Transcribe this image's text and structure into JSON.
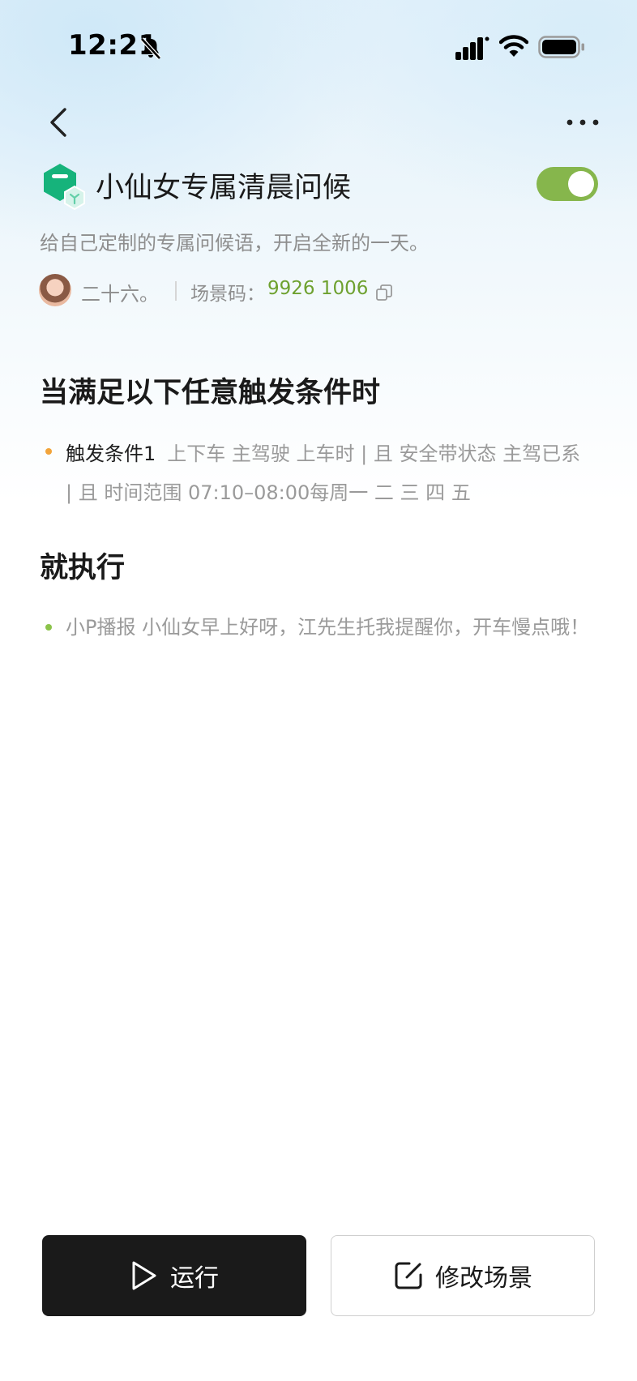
{
  "status_bar": {
    "time": "12:21",
    "icons": [
      "bell-off-icon",
      "signal-icon",
      "wifi-icon",
      "battery-icon"
    ]
  },
  "nav": {
    "back_icon": "chevron-left-icon",
    "more_icon": "more-horizontal-icon"
  },
  "scene": {
    "icon": "scene-cube-icon",
    "title": "小仙女专属清晨问候",
    "enabled": true,
    "description": "给自己定制的专属问候语，开启全新的一天。",
    "author": "二十六。",
    "code_label": "场景码：",
    "code_value": "9926 1006",
    "copy_icon": "copy-icon"
  },
  "conditions": {
    "heading": "当满足以下任意触发条件时",
    "items": [
      {
        "label": "触发条件1",
        "text": "上下车 主驾驶 上车时 | 且 安全带状态 主驾已系 | 且 时间范围 07:10–08:00每周一 二 三 四 五"
      }
    ]
  },
  "actions": {
    "heading": "就执行",
    "items": [
      {
        "text": "小P播报 小仙女早上好呀，江先生托我提醒你，开车慢点哦！"
      }
    ]
  },
  "buttons": {
    "run_label": "运行",
    "edit_label": "修改场景"
  },
  "colors": {
    "accent_green": "#86b64c",
    "code_green": "#6ea12f",
    "scene_icon_green": "#16b37b",
    "condition_dot": "#f2a43a",
    "action_dot": "#8bc34a"
  }
}
